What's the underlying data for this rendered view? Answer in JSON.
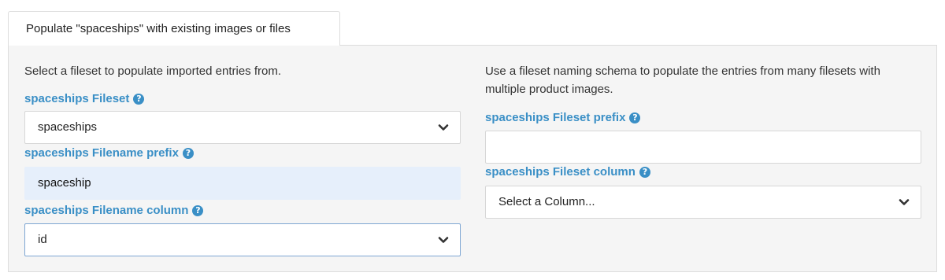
{
  "tab": {
    "label": "Populate \"spaceships\" with existing images or files"
  },
  "left": {
    "intro": "Select a fileset to populate imported entries from.",
    "fileset_label": "spaceships Fileset",
    "fileset_value": "spaceships",
    "filename_prefix_label": "spaceships Filename prefix",
    "filename_prefix_value": "spaceship",
    "filename_column_label": "spaceships Filename column",
    "filename_column_value": "id"
  },
  "right": {
    "intro": "Use a fileset naming schema to populate the entries from many filesets with multiple product images.",
    "fileset_prefix_label": "spaceships Fileset prefix",
    "fileset_prefix_value": "",
    "fileset_column_label": "spaceships Fileset column",
    "fileset_column_value": "Select a Column..."
  },
  "icons": {
    "help": "?",
    "help_name": "question-circle-icon",
    "select_name": "chevron-down-icon"
  },
  "colors": {
    "label": "#3a8fc6",
    "panel_bg": "#f5f5f5",
    "filled_input_bg": "#e6effb"
  }
}
